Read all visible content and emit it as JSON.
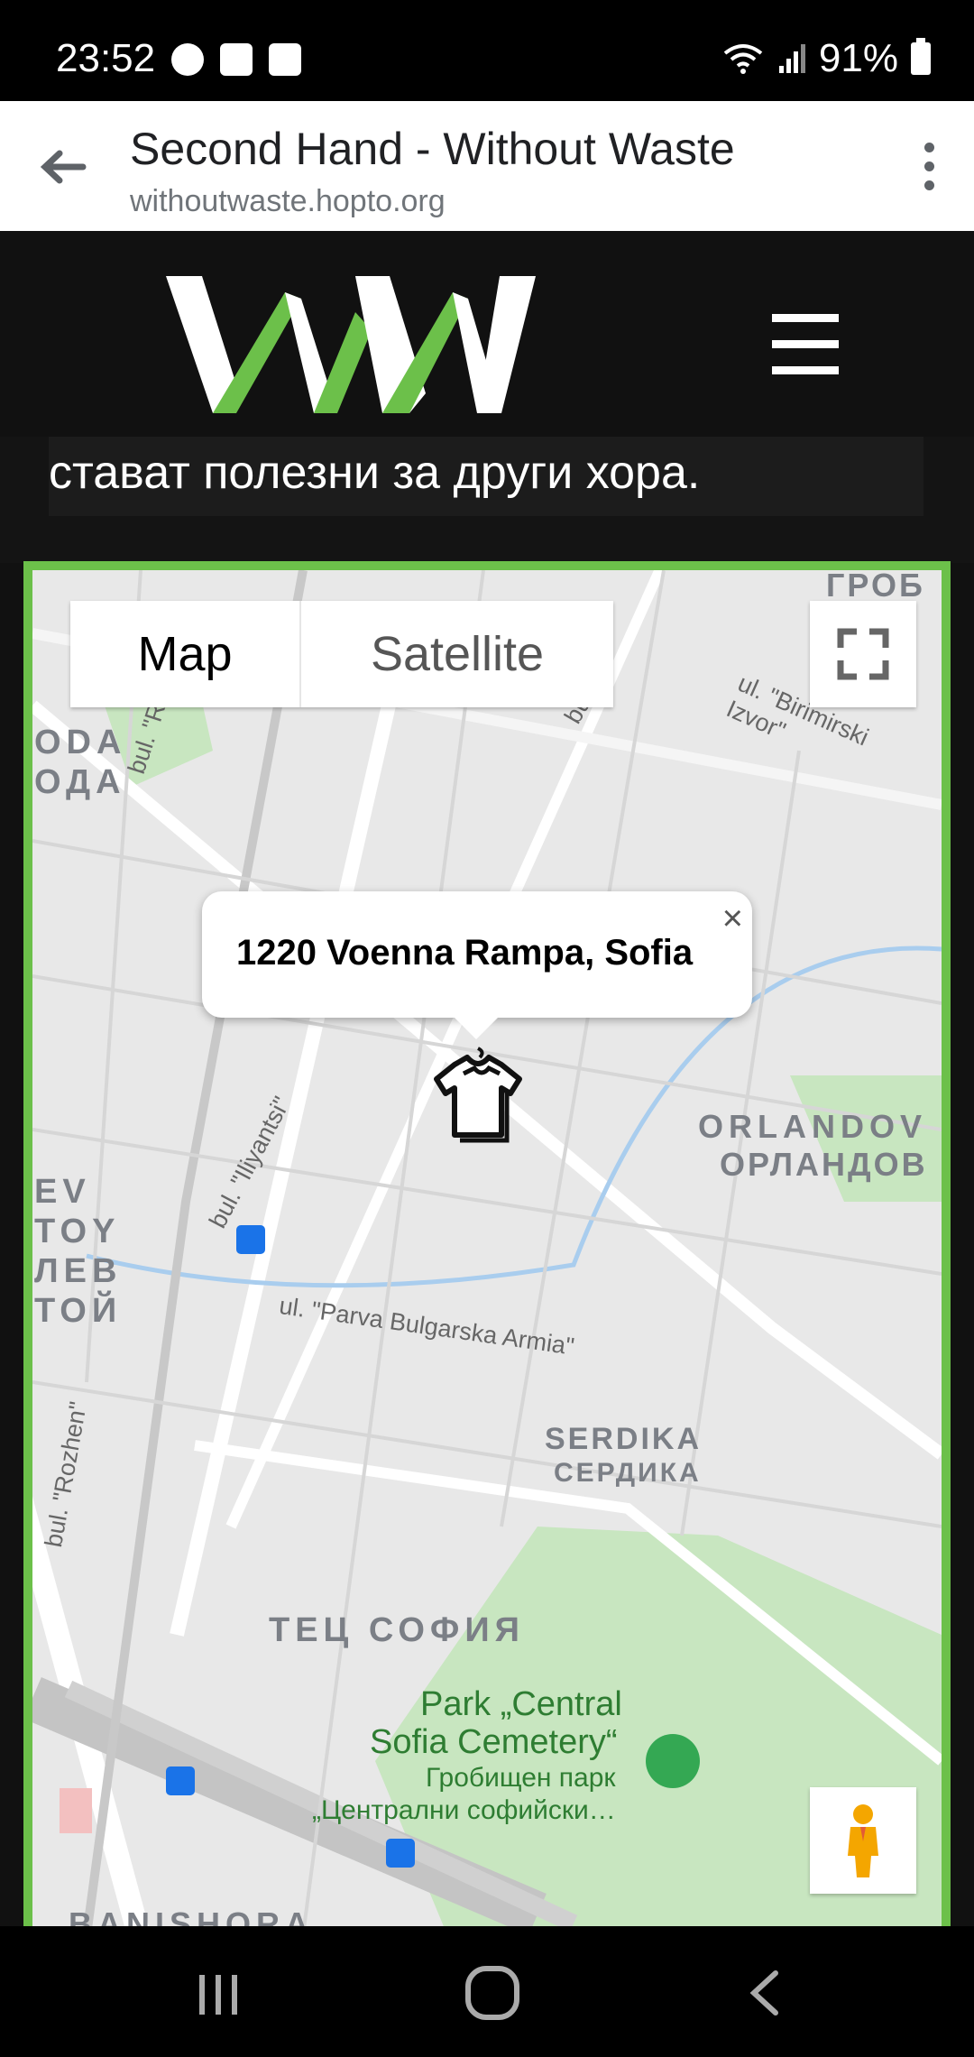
{
  "status_bar": {
    "time": "23:52",
    "battery": "91%"
  },
  "browser": {
    "title": "Second Hand - Without Waste",
    "url": "withoutwaste.hopto.org"
  },
  "page": {
    "text_line": "стават полезни за други хора."
  },
  "map": {
    "map_type_map": "Map",
    "map_type_satellite": "Satellite",
    "popup_text": "1220 Voenna Rampa, Sofia",
    "popup_close": "×",
    "labels": {
      "oda_lat": "ODA",
      "oda_cyr": "ОДА",
      "ev_lat": "EV",
      "toy_lat": "TOY",
      "lev_cyr": "ЛЕВ",
      "toy_cyr": "ТОЙ",
      "orlandov_lat": "ORLANDOV",
      "orlandov_cyr": "ОРЛАНДОВ",
      "serdika_lat": "SERDIKA",
      "serdika_cyr": "СЕРДИКА",
      "tets_sofia": "ТЕЦ СОФИЯ",
      "park_1": "Park „Central",
      "park_2": "Sofia Cemetery“",
      "park_3": "Гробищен парк",
      "park_4": "„Централни софийски…",
      "banishora": "BANISHORA",
      "grob": "ГРОБ",
      "rozhen_1": "bul. \"Rozhen\"",
      "rozhen_2": "bul. \"Rozhen\"",
      "iliyantsi": "bul. \"Iliyantsi\"",
      "birimirski": "ul. \"Birimirski Izvor\"",
      "parva": "ul. \"Parva Bulgarska Armia\"",
      "bul_top": "bul."
    }
  },
  "colors": {
    "accent_green": "#6cc04a",
    "header_bg": "#111111",
    "map_bg": "#e5e5e5"
  }
}
